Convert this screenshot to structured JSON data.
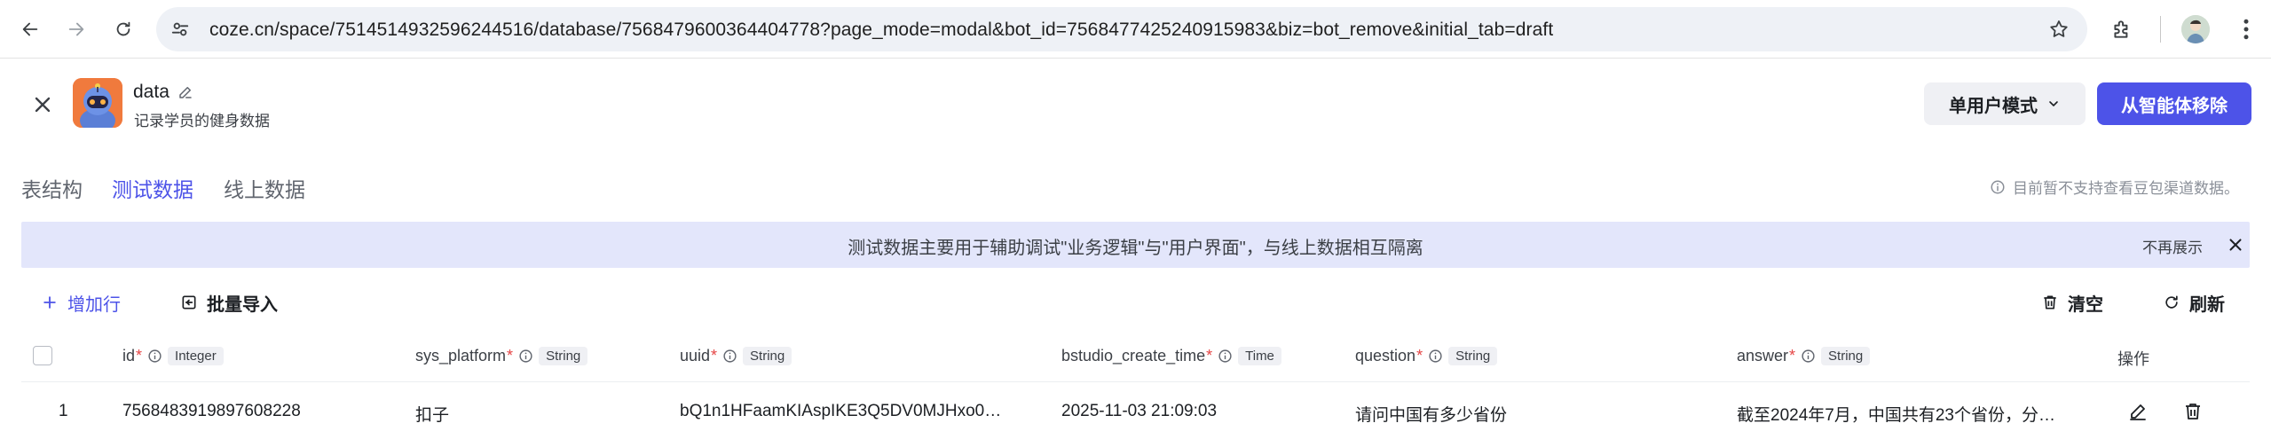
{
  "browser": {
    "url": "coze.cn/space/7514514932596244516/database/7568479600364404778?page_mode=modal&bot_id=7568477425240915983&biz=bot_remove&initial_tab=draft"
  },
  "header": {
    "bot_name": "data",
    "bot_description": "记录学员的健身数据",
    "mode_label": "单用户模式",
    "remove_label": "从智能体移除"
  },
  "tabs": [
    {
      "label": "表结构",
      "active": false
    },
    {
      "label": "测试数据",
      "active": true
    },
    {
      "label": "线上数据",
      "active": false
    }
  ],
  "notice": "目前暂不支持查看豆包渠道数据。",
  "banner": {
    "text": "测试数据主要用于辅助调试\"业务逻辑\"与\"用户界面\"，与线上数据相互隔离",
    "dismiss_label": "不再展示"
  },
  "toolbar": {
    "add_row_label": "增加行",
    "batch_import_label": "批量导入",
    "clear_label": "清空",
    "refresh_label": "刷新"
  },
  "table": {
    "columns": [
      {
        "name": "id",
        "type": "Integer"
      },
      {
        "name": "sys_platform",
        "type": "String"
      },
      {
        "name": "uuid",
        "type": "String"
      },
      {
        "name": "bstudio_create_time",
        "type": "Time"
      },
      {
        "name": "question",
        "type": "String"
      },
      {
        "name": "answer",
        "type": "String"
      }
    ],
    "actions_header": "操作",
    "rows": [
      {
        "index": "1",
        "id": "7568483919897608228",
        "sys_platform": "扣子",
        "uuid": "bQ1n1HFaamKIAspIKE3Q5DV0MJHxo0…",
        "bstudio_create_time": "2025-11-03 21:09:03",
        "question": "请问中国有多少省份",
        "answer": "截至2024年7月，中国共有23个省份，分…"
      }
    ]
  },
  "colors": {
    "accent": "#4d53e8",
    "banner_bg": "#e3e6fb",
    "required": "#e54545"
  }
}
